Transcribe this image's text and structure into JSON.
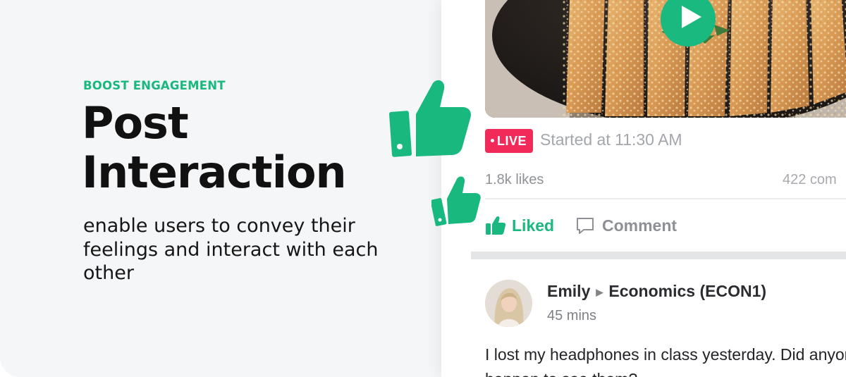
{
  "hero": {
    "eyebrow": "BOOST ENGAGEMENT",
    "title_line1": "Post",
    "title_line2": "Interaction",
    "subtext": "enable users to convey their feelings and interact with each other"
  },
  "live_post": {
    "badge": "LIVE",
    "started": "Started at 11:30 AM",
    "likes": "1.8k likes",
    "comments": "422 com",
    "like_action": "Liked",
    "comment_action": "Comment"
  },
  "post": {
    "author": "Emily",
    "group": "Economics (ECON1)",
    "time": "45 mins",
    "text": "I lost my headphones in class yesterday. Did anyone happen to see them?"
  },
  "colors": {
    "accent": "#19b87e",
    "live": "#f12a5a",
    "panel_bg": "#f5f6f8"
  },
  "icons": [
    "thumbs-up-icon",
    "play-icon",
    "comment-icon",
    "caret-right-icon"
  ]
}
